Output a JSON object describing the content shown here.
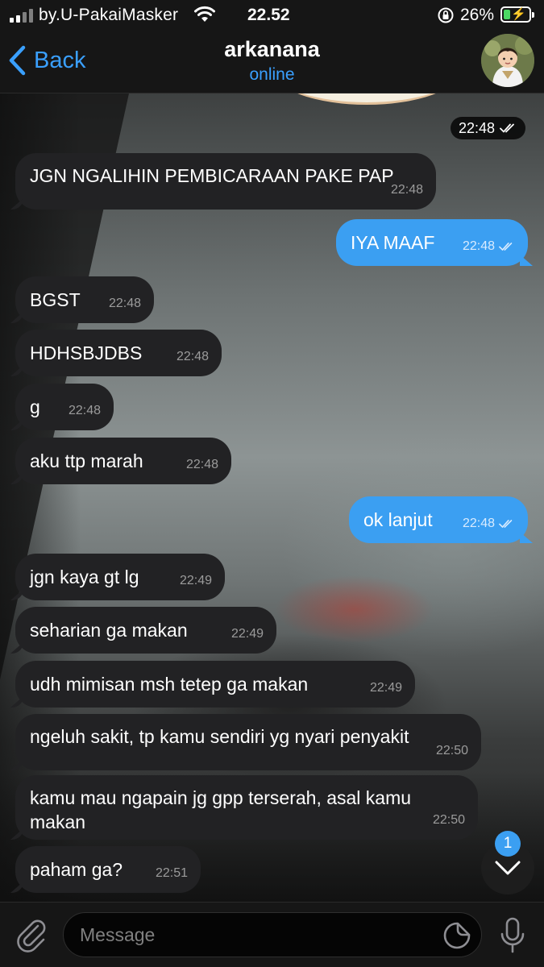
{
  "status_bar": {
    "carrier": "by.U-PakaiMasker",
    "time": "22.52",
    "battery_percent": "26%",
    "battery_level": 0.26,
    "charging": true,
    "icons": [
      "signal-icon",
      "wifi-icon",
      "rotation-lock-icon",
      "battery-charging-icon"
    ]
  },
  "header": {
    "back_label": "Back",
    "chat_name": "arkanana",
    "status": "online"
  },
  "date_pill": {
    "time": "22:48"
  },
  "messages": [
    {
      "direction": "in",
      "text": "JGN NGALIHIN PEMBICARAAN PAKE PAP",
      "time": "22:48"
    },
    {
      "direction": "out",
      "text": "IYA MAAF",
      "time": "22:48",
      "read": true
    },
    {
      "direction": "in",
      "text": "BGST",
      "time": "22:48"
    },
    {
      "direction": "in",
      "text": "HDHSBJDBS",
      "time": "22:48"
    },
    {
      "direction": "in",
      "text": "g",
      "time": "22:48"
    },
    {
      "direction": "in",
      "text": "aku ttp marah",
      "time": "22:48"
    },
    {
      "direction": "out",
      "text": "ok lanjut",
      "time": "22:48",
      "read": true
    },
    {
      "direction": "in",
      "text": "jgn kaya gt lg",
      "time": "22:49"
    },
    {
      "direction": "in",
      "text": "seharian ga makan",
      "time": "22:49"
    },
    {
      "direction": "in",
      "text": "udh mimisan msh tetep ga makan",
      "time": "22:49"
    },
    {
      "direction": "in",
      "text": "ngeluh sakit, tp kamu sendiri yg nyari penyakit",
      "time": "22:50"
    },
    {
      "direction": "in",
      "text": "kamu mau ngapain jg gpp terserah, asal kamu makan",
      "time": "22:50"
    },
    {
      "direction": "in",
      "text": "paham ga?",
      "time": "22:51"
    }
  ],
  "scroll_down": {
    "unread_count": "1"
  },
  "composer": {
    "placeholder": "Message"
  },
  "colors": {
    "accent": "#3aa0ff",
    "outgoing_bubble": "#3b9ff2",
    "incoming_bubble": "#222224"
  }
}
